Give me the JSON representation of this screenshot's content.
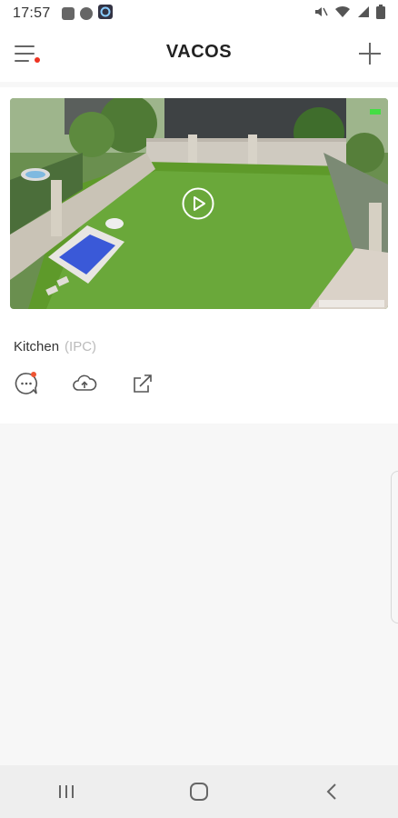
{
  "status_bar": {
    "time": "17:57",
    "left_icons": [
      "image-icon",
      "pinwheel-icon",
      "app-c-icon"
    ],
    "right_icons": [
      "mute-icon",
      "wifi-icon",
      "signal-icon",
      "battery-icon"
    ]
  },
  "header": {
    "logo": "VACOS",
    "menu_icon": "hamburger-menu-icon",
    "add_icon": "plus-icon",
    "notification_dot_color": "#ee3322"
  },
  "device": {
    "name": "Kitchen",
    "type": "(IPC)",
    "preview_icon": "play-icon",
    "actions": [
      "message-icon",
      "cloud-icon",
      "share-icon"
    ]
  },
  "nav": {
    "buttons": [
      "recents-icon",
      "home-icon",
      "back-icon"
    ]
  }
}
